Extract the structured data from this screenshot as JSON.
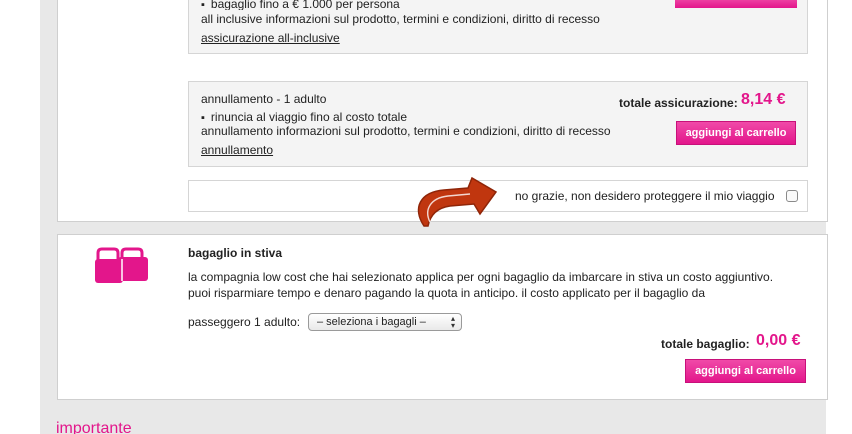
{
  "insurance": {
    "allinclusive": {
      "bullet_text": "bagaglio fino a € 1.000 per persona",
      "info_text": "all inclusive informazioni sul prodotto, termini e condizioni, diritto di recesso",
      "link_text": "assicurazione all-inclusive"
    },
    "cancellation": {
      "title": "annullamento - 1 adulto",
      "bullet_text": "rinuncia al viaggio fino al costo totale",
      "info_text": "annullamento informazioni sul prodotto, termini e condizioni, diritto di recesso",
      "link_text": "annullamento",
      "total_label": "totale assicurazione:",
      "total_value": "8,14 €",
      "add_button": "aggiungi al carrello"
    },
    "decline_text": "no grazie, non desidero proteggere il mio viaggio"
  },
  "baggage": {
    "title": "bagaglio in stiva",
    "description_line1": "la compagnia low cost che hai selezionato applica per ogni bagaglio da imbarcare in stiva un costo aggiuntivo.",
    "description_line2": "puoi risparmiare tempo e denaro pagando la quota in anticipo. il costo applicato per il bagaglio da",
    "passenger_label": "passeggero 1 adulto:",
    "select_value": "– seleziona i bagagli –",
    "total_label": "totale bagaglio:",
    "total_value": "0,00 €",
    "add_button": "aggiungi al carrello"
  },
  "footer": {
    "importante": "importante"
  },
  "colors": {
    "accent": "#e3168b",
    "arrow": "#c0360f"
  },
  "icons": {
    "baggage": "suitcase-icon",
    "arrow": "curved-arrow-icon"
  }
}
